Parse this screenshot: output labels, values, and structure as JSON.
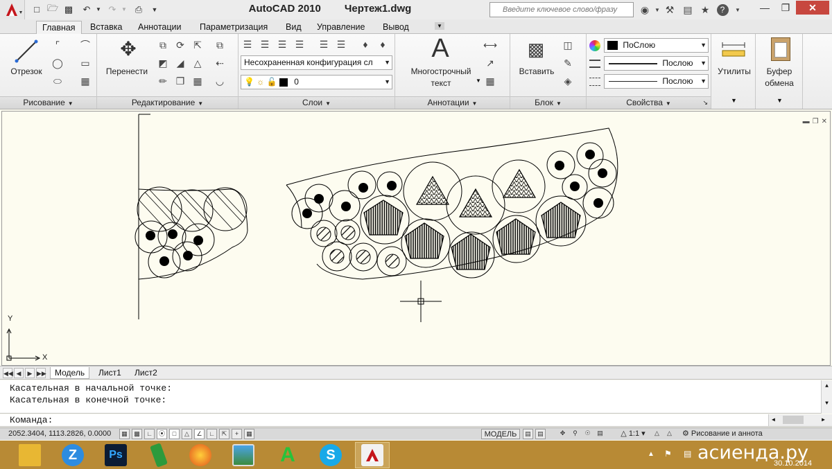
{
  "title_bar": {
    "app_name": "AutoCAD 2010",
    "document": "Чертеж1.dwg",
    "search_placeholder": "Введите ключевое слово/фразу"
  },
  "tabs": [
    {
      "label": "Главная",
      "active": true
    },
    {
      "label": "Вставка"
    },
    {
      "label": "Аннотации"
    },
    {
      "label": "Параметризация"
    },
    {
      "label": "Вид"
    },
    {
      "label": "Управление"
    },
    {
      "label": "Вывод"
    }
  ],
  "ribbon": {
    "draw": {
      "title": "Рисование",
      "line_label": "Отрезок"
    },
    "modify": {
      "title": "Редактирование",
      "move_label": "Перенести"
    },
    "layers": {
      "title": "Слои",
      "config_value": "Несохраненная конфигурация сл",
      "layer_value": "0"
    },
    "annotation": {
      "title": "Аннотации",
      "mtext_label_1": "Многострочный",
      "mtext_label_2": "текст"
    },
    "block": {
      "title": "Блок",
      "insert_label": "Вставить"
    },
    "properties": {
      "title": "Свойства",
      "color_value": "ПоСлою",
      "linetype_value": "Послою",
      "lineweight_value": "Послою"
    },
    "utilities": {
      "label": "Утилиты"
    },
    "clipboard": {
      "label_1": "Буфер",
      "label_2": "обмена"
    }
  },
  "canvas": {
    "axis_x": "X",
    "axis_y": "Y"
  },
  "layout_tabs": [
    "Модель",
    "Лист1",
    "Лист2"
  ],
  "command": {
    "history": [
      "Касательная в начальной точке:",
      "Касательная в конечной точке:"
    ],
    "prompt": "Команда:"
  },
  "status": {
    "coordinates": "2052.3404, 1113.2826, 0.0000",
    "model_label": "МОДЕЛЬ",
    "scale": "1:1",
    "workspace": "Рисование и аннота"
  },
  "taskbar": {
    "apps": [
      "file-explorer",
      "zoom",
      "photoshop",
      "coreldraw",
      "firefox",
      "image-viewer",
      "archicad",
      "skype",
      "autocad"
    ],
    "date": "30.10.2014",
    "watermark": "асиенда.ру"
  }
}
